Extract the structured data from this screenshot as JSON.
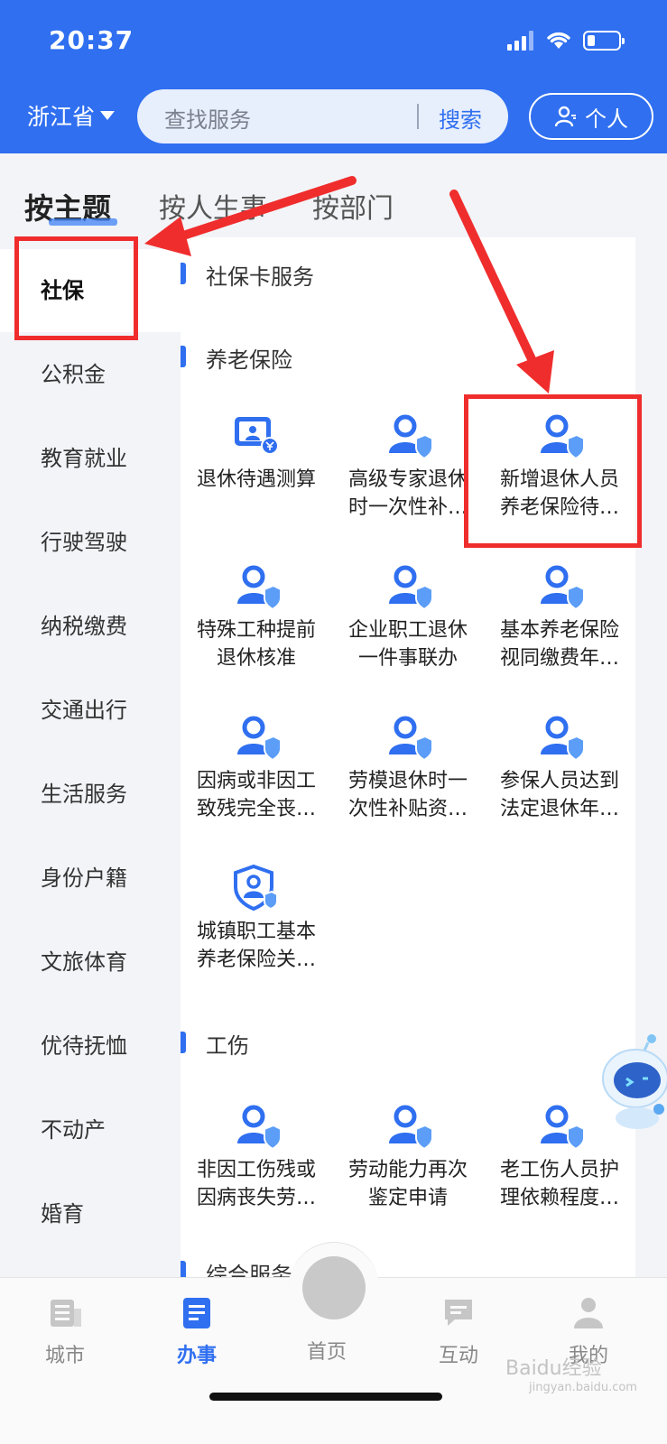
{
  "status_bar": {
    "time": "20:37"
  },
  "header": {
    "province": "浙江省",
    "search_placeholder": "查找服务",
    "search_button": "搜索",
    "profile_button": "个人"
  },
  "tabs": [
    {
      "label": "按主题",
      "active": true
    },
    {
      "label": "按人生事",
      "active": false
    },
    {
      "label": "按部门",
      "active": false
    }
  ],
  "sidebar": {
    "items": [
      {
        "label": "社保",
        "active": true
      },
      {
        "label": "公积金"
      },
      {
        "label": "教育就业"
      },
      {
        "label": "行驶驾驶"
      },
      {
        "label": "纳税缴费"
      },
      {
        "label": "交通出行"
      },
      {
        "label": "生活服务"
      },
      {
        "label": "身份户籍"
      },
      {
        "label": "文旅体育"
      },
      {
        "label": "优待抚恤"
      },
      {
        "label": "不动产"
      },
      {
        "label": "婚育"
      }
    ]
  },
  "sections": [
    {
      "title": "社保卡服务"
    },
    {
      "title": "养老保险",
      "services": [
        {
          "line1": "退休待遇测算",
          "line2": "",
          "icon": "calculator-icon"
        },
        {
          "line1": "高级专家退休",
          "line2": "时一次性补…",
          "icon": "person-shield-icon"
        },
        {
          "line1": "新增退休人员",
          "line2": "养老保险待…",
          "icon": "person-shield-icon"
        },
        {
          "line1": "特殊工种提前",
          "line2": "退休核准",
          "icon": "person-shield-icon"
        },
        {
          "line1": "企业职工退休",
          "line2": "一件事联办",
          "icon": "person-shield-icon"
        },
        {
          "line1": "基本养老保险",
          "line2": "视同缴费年…",
          "icon": "person-shield-icon"
        },
        {
          "line1": "因病或非因工",
          "line2": "致残完全丧…",
          "icon": "person-shield-icon"
        },
        {
          "line1": "劳模退休时一",
          "line2": "次性补贴资…",
          "icon": "person-shield-icon"
        },
        {
          "line1": "参保人员达到",
          "line2": "法定退休年…",
          "icon": "person-shield-icon"
        },
        {
          "line1": "城镇职工基本",
          "line2": "养老保险关…",
          "icon": "shield-person-icon"
        }
      ]
    },
    {
      "title": "工伤",
      "services": [
        {
          "line1": "非因工伤残或",
          "line2": "因病丧失劳…",
          "icon": "person-shield-icon"
        },
        {
          "line1": "劳动能力再次",
          "line2": "鉴定申请",
          "icon": "person-shield-icon"
        },
        {
          "line1": "老工伤人员护",
          "line2": "理依赖程度…",
          "icon": "person-shield-icon"
        }
      ]
    },
    {
      "title": "综合服务"
    }
  ],
  "bottom_nav": [
    {
      "label": "城市",
      "icon": "city-icon"
    },
    {
      "label": "办事",
      "icon": "document-icon",
      "active": true
    },
    {
      "label": "首页",
      "icon": "home-logo-icon"
    },
    {
      "label": "互动",
      "icon": "chat-icon"
    },
    {
      "label": "我的",
      "icon": "user-icon"
    }
  ],
  "watermark": {
    "text": "Baidu经验",
    "sub": "jingyan.baidu.com"
  },
  "colors": {
    "brand_blue": "#2f6ff0",
    "annotation_red": "#f02d2d",
    "page_bg": "#f2f4f8"
  }
}
